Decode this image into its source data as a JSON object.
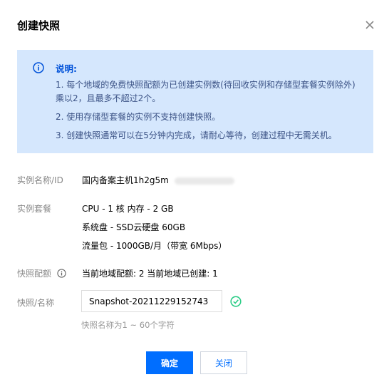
{
  "dialog": {
    "title": "创建快照",
    "close_icon": "close-icon"
  },
  "notice": {
    "icon": "info-icon",
    "heading": "说明:",
    "items": [
      "1. 每个地域的免费快照配额为已创建实例数(待回收实例和存储型套餐实例除外)乘以2，且最多不超过2个。",
      "2. 使用存储型套餐的实例不支持创建快照。",
      "3. 创建快照通常可以在5分钟内完成，请耐心等待，创建过程中无需关机。"
    ],
    "colors": {
      "background": "#d5e7fd",
      "accent": "#0052d9"
    }
  },
  "fields": {
    "instance_name_label": "实例名称/ID",
    "instance_name_value": "国内备案主机1h2g5m",
    "plan_label": "实例套餐",
    "plan_lines": [
      "CPU - 1 核 内存 - 2 GB",
      "系统盘 - SSD云硬盘 60GB",
      "流量包 - 1000GB/月（带宽 6Mbps）"
    ],
    "quota_label": "快照配额",
    "quota_value": "当前地域配额: 2 当前地域已创建: 1",
    "snapshot_name_label": "快照/名称",
    "snapshot_name_value": "Snapshot-20211229152743",
    "snapshot_name_hint": "快照名称为1 ~ 60个字符"
  },
  "buttons": {
    "confirm_label": "确定",
    "close_label": "关闭"
  },
  "colors": {
    "primary": "#006eff",
    "success": "#29cc85",
    "label": "#888888"
  }
}
